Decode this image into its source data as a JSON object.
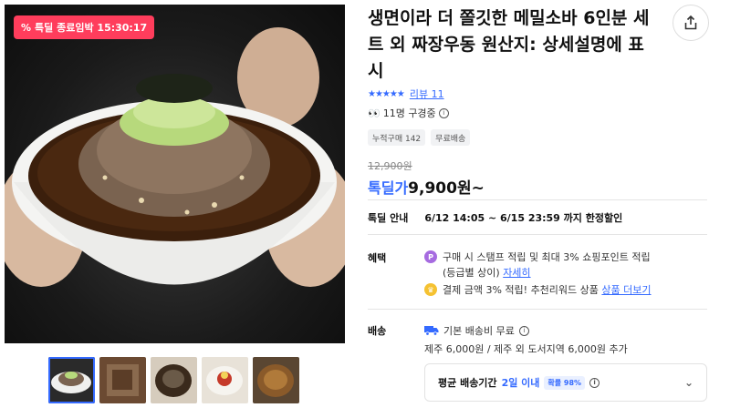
{
  "deal_badge": {
    "icon": "percent-icon",
    "text": "특딜 종료임박 15:30:17"
  },
  "product": {
    "title": "생면이라 더 쫄깃한 메밀소바 6인분 세트 외 짜장우동 원산지: 상세설명에 표시"
  },
  "rating": {
    "stars": "★★★★★",
    "review_text": "리뷰 11"
  },
  "watching": {
    "icon": "eyes-icon",
    "text": "11명 구경중"
  },
  "tags": [
    "누적구매 142",
    "무료배송"
  ],
  "price": {
    "original": "12,900원",
    "label": "톡딜가",
    "value": "9,900원~"
  },
  "deal_info": {
    "label": "톡딜 안내",
    "period": "6/12 14:05 ~ 6/15 23:59 까지 한정할인"
  },
  "benefits": {
    "label": "혜택",
    "item1_text": "구매 시 스탬프 적립 및 최대 3% 쇼핑포인트 적립",
    "item1_sub": "(등급별 상이)",
    "item1_link": "자세히",
    "item1_icon_letter": "P",
    "item2_text": "결제 금액 3% 적립! 추천리워드 상품",
    "item2_link": "상품 더보기"
  },
  "shipping": {
    "label": "배송",
    "basic": "기본 배송비 무료",
    "extra": "제주 6,000원 / 제주 외 도서지역 6,000원 추가",
    "avg_label": "평균 배송기간",
    "avg_value": "2일 이내",
    "prob": "확률 98%"
  },
  "colors": {
    "accent": "#346aff",
    "badge": "#ff3d5c"
  }
}
